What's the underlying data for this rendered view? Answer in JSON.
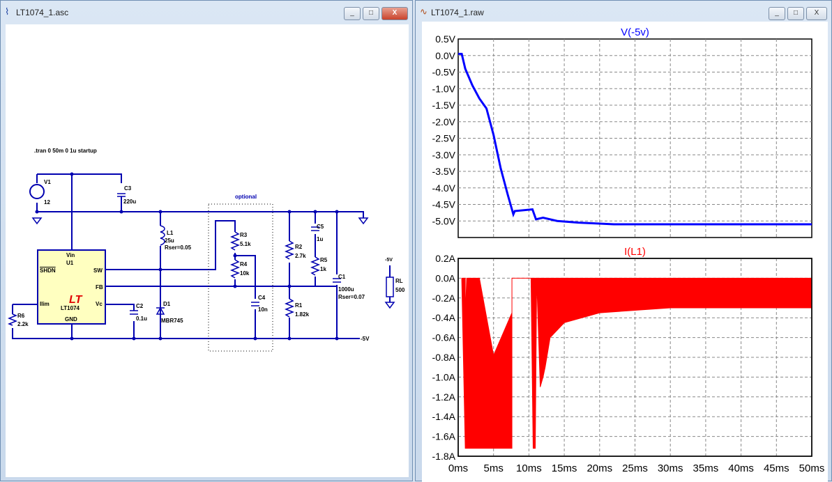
{
  "schematic_window": {
    "title": "LT1074_1.asc",
    "minimize": "_",
    "maximize": "□",
    "close": "X",
    "directive": ".tran 0 50m 0 1u startup",
    "parts": {
      "V1": "V1",
      "V1v": "12",
      "C3": "C3",
      "C3v": "220u",
      "L1": "L1",
      "L1v": "25u",
      "L1r": "Rser=0.05",
      "U1": "U1",
      "U1type": "LT1074",
      "vin": "Vin",
      "shdn": "SHDN",
      "sw": "SW",
      "fb": "FB",
      "ilim": "Ilim",
      "vc": "Vc",
      "gnd": "GND",
      "C2": "C2",
      "C2v": "0.1u",
      "D1": "D1",
      "D1v": "MBR745",
      "R6": "R6",
      "R6v": "2.2k",
      "R3": "R3",
      "R3v": "5.1k",
      "R4": "R4",
      "R4v": "10k",
      "C4": "C4",
      "C4v": "10n",
      "R2": "R2",
      "R2v": "2.7k",
      "R1": "R1",
      "R1v": "1.82k",
      "C5": "C5",
      "C5v": "1u",
      "R5": "R5",
      "R5v": "1k",
      "C1": "C1",
      "C1v": "1000u",
      "C1r": "Rser=0.07",
      "RL": "RL",
      "RLv": "500",
      "net": "-5V",
      "netRL": "-5V",
      "optional": "optional"
    }
  },
  "waveform_window": {
    "title": "LT1074_1.raw",
    "minimize": "_",
    "maximize": "□",
    "close": "X"
  },
  "chart_data": [
    {
      "type": "line",
      "title": "V(-5v)",
      "color": "#0000ff",
      "ylim": [
        -5.5,
        0.5
      ],
      "yticks": [
        "0.5V",
        "0.0V",
        "-0.5V",
        "-1.0V",
        "-1.5V",
        "-2.0V",
        "-2.5V",
        "-3.0V",
        "-3.5V",
        "-4.0V",
        "-4.5V",
        "-5.0V"
      ],
      "x": [
        0,
        0.5,
        1,
        2,
        3,
        4,
        5,
        6,
        7,
        7.8,
        8,
        10.5,
        11,
        12,
        14,
        17,
        20,
        22,
        50
      ],
      "y": [
        0.05,
        0.05,
        -0.4,
        -0.9,
        -1.3,
        -1.6,
        -2.4,
        -3.4,
        -4.2,
        -4.8,
        -4.7,
        -4.65,
        -4.95,
        -4.9,
        -5.0,
        -5.05,
        -5.08,
        -5.1,
        -5.1
      ]
    },
    {
      "type": "area",
      "title": "I(L1)",
      "color": "#ff0000",
      "ylim": [
        -1.8,
        0.2
      ],
      "yticks": [
        "0.2A",
        "0.0A",
        "-0.2A",
        "-0.4A",
        "-0.6A",
        "-0.8A",
        "-1.0A",
        "-1.2A",
        "-1.4A",
        "-1.6A",
        "-1.8A"
      ],
      "xticks": [
        "0ms",
        "5ms",
        "10ms",
        "15ms",
        "20ms",
        "25ms",
        "30ms",
        "35ms",
        "40ms",
        "45ms",
        "50ms"
      ],
      "xlim": [
        0,
        50
      ],
      "upper": [
        [
          0.5,
          0
        ],
        [
          1,
          0
        ],
        [
          1,
          -0.4
        ],
        [
          1.2,
          0
        ],
        [
          3,
          0
        ],
        [
          5,
          -0.78
        ],
        [
          7.6,
          -0.35
        ],
        [
          7.6,
          0
        ],
        [
          10.3,
          0
        ],
        [
          10.5,
          0
        ],
        [
          11,
          0
        ],
        [
          11.4,
          0
        ],
        [
          12,
          0
        ],
        [
          50,
          0
        ]
      ],
      "lower": [
        [
          0.5,
          0
        ],
        [
          1,
          -1.72
        ],
        [
          7.6,
          -1.72
        ],
        [
          7.6,
          0
        ],
        [
          10.3,
          0
        ],
        [
          10.6,
          -1.72
        ],
        [
          10.9,
          -1.72
        ],
        [
          11.1,
          0
        ],
        [
          11.6,
          -1.1
        ],
        [
          12,
          -1.0
        ],
        [
          12.3,
          -0.9
        ],
        [
          13,
          -0.6
        ],
        [
          15,
          -0.45
        ],
        [
          20,
          -0.35
        ],
        [
          30,
          -0.3
        ],
        [
          50,
          -0.3
        ]
      ]
    }
  ]
}
